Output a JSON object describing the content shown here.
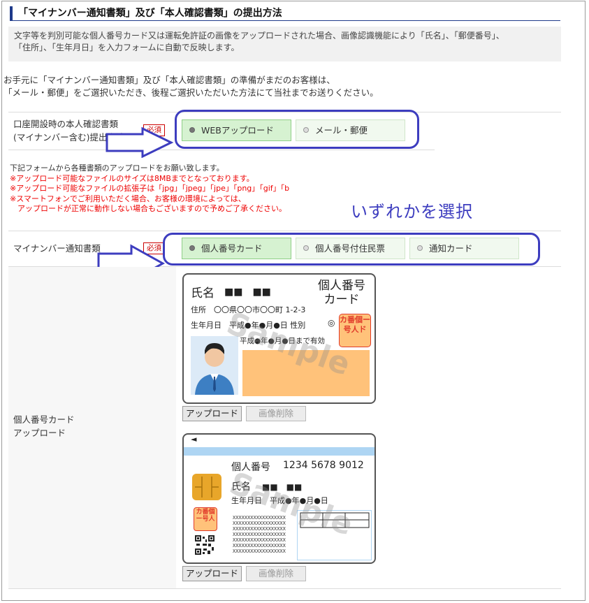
{
  "section_title": "「マイナンバー通知書類」及び「本人確認書類」の提出方法",
  "info_lines": [
    "文字等を判別可能な個人番号カード又は運転免許証の画像をアップロードされた場合、画像認識機能により「氏名」、「郵便番号」、",
    "「住所」、「生年月日」を入力フォームに自動で反映します。"
  ],
  "notice_lines": [
    "お手元に「マイナンバー通知書類」及び「本人確認書類」の準備がまだのお客様は、",
    "「メール・郵便」をご選択いただき、後程ご選択いただいた方法にて当社までお送りください。"
  ],
  "required_badge": "必須",
  "row1": {
    "label_lines": [
      "口座開設時の本人確認書類",
      "(マイナンバー含む)提出方法"
    ],
    "options": [
      {
        "label": "WEBアップロード",
        "selected": true
      },
      {
        "label": "メール・郵便",
        "selected": false
      }
    ]
  },
  "upload_info": {
    "line1": "下記フォームから各種書類のアップロードをお願い致します。",
    "warnings": [
      "※アップロード可能なファイルのサイズは8MBまでとなっております。",
      "※アップロード可能なファイルの拡張子は「jpg」「jpeg」「jpe」「png」「gif」「b",
      "※スマートフォンでご利用いただく場合、お客様の環境によっては、",
      "　アップロードが正常に動作しない場合もございますので予めご了承ください。"
    ]
  },
  "annotation": "いずれかを選択",
  "row2": {
    "label": "マイナンバー通知書類",
    "options": [
      {
        "label": "個人番号カード",
        "selected": true
      },
      {
        "label": "個人番号付住民票",
        "selected": false
      },
      {
        "label": "通知カード",
        "selected": false
      }
    ]
  },
  "row3": {
    "label_lines": [
      "個人番号カード",
      "アップロード"
    ]
  },
  "card_front": {
    "name_label": "氏名",
    "name_mask": "■■　■■",
    "title_lines": [
      "個人番号",
      "カード"
    ],
    "address": "住所　〇〇県〇〇市〇〇町 1-2-3",
    "birth": "生年月日　平成●年●月●日 性別",
    "gender_mark": "◎",
    "expiry": "平成●年●月●日まで有効",
    "seal_chars": [
      "個",
      "番",
      "人",
      "号",
      "カ",
      "ー",
      "ド"
    ],
    "watermark": "Sample"
  },
  "card_back": {
    "arrow": "◄",
    "number_label": "個人番号",
    "number_value": "1234 5678 9012",
    "name_label": "氏名",
    "name_mask": "■■　■■",
    "birth": "生年月日　平成●年●月●日",
    "seal_chars": [
      "個",
      "番",
      "人",
      "号",
      "カ",
      "ー",
      "ド"
    ],
    "x_lines": [
      "XXXXXXXXXXXXXXXXXX",
      "XXXXXXXXXXXXXXXXXX",
      "XXXXXXXXXXXXXXXXXX",
      "XXXXXXXXXXXXXXXXXX",
      "XXXXXXXXXXXXXXXXXX",
      "XXXXXXXXXXXXXXXXXX",
      "XXXXXXXXXXXXXXXXXX"
    ],
    "watermark": "Sample"
  },
  "buttons": {
    "upload": "アップロード",
    "delete": "画像削除"
  },
  "colors": {
    "accent": "#1e3a8a",
    "annotation": "#3d3dbf",
    "required": "#cc0000",
    "option_selected": "#d6f2d1",
    "option": "#f1f9ef",
    "photo_bg": "#ffc27a",
    "chip": "#e8a62a"
  }
}
